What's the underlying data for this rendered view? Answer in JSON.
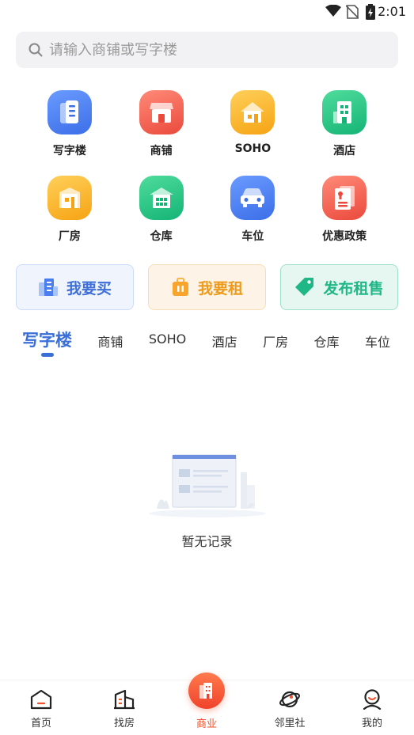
{
  "status_bar": {
    "time": "2:01"
  },
  "search": {
    "placeholder": "请输入商铺或写字楼"
  },
  "categories": [
    {
      "label": "写字楼",
      "icon": "office-building-icon",
      "color": "#4a7ef0"
    },
    {
      "label": "商铺",
      "icon": "shop-icon",
      "color": "#f0564a"
    },
    {
      "label": "SOHO",
      "icon": "home-icon",
      "color": "#f9b21c"
    },
    {
      "label": "酒店",
      "icon": "hotel-icon",
      "color": "#22c283"
    },
    {
      "label": "厂房",
      "icon": "factory-icon",
      "color": "#f9b21c"
    },
    {
      "label": "仓库",
      "icon": "warehouse-icon",
      "color": "#22c283"
    },
    {
      "label": "车位",
      "icon": "car-icon",
      "color": "#4a7ef0"
    },
    {
      "label": "优惠政策",
      "icon": "policy-document-icon",
      "color": "#f0564a"
    }
  ],
  "actions": [
    {
      "label": "我要买",
      "icon": "buildings-icon"
    },
    {
      "label": "我要租",
      "icon": "briefcase-icon"
    },
    {
      "label": "发布租售",
      "icon": "tag-icon"
    }
  ],
  "tabs": [
    "写字楼",
    "商铺",
    "SOHO",
    "酒店",
    "厂房",
    "仓库",
    "车位"
  ],
  "active_tab": "写字楼",
  "empty_state": {
    "text": "暂无记录"
  },
  "bottom_nav": [
    {
      "label": "首页",
      "icon": "home-icon"
    },
    {
      "label": "找房",
      "icon": "buildings-icon"
    },
    {
      "label": "商业",
      "icon": "commercial-building-icon"
    },
    {
      "label": "邻里社",
      "icon": "planet-icon"
    },
    {
      "label": "我的",
      "icon": "profile-icon"
    }
  ],
  "active_nav": "商业",
  "colors": {
    "accent_blue": "#3a6fd8",
    "accent_orange": "#ee9a1c",
    "accent_green": "#1fb786",
    "accent_red": "#f2522c"
  }
}
